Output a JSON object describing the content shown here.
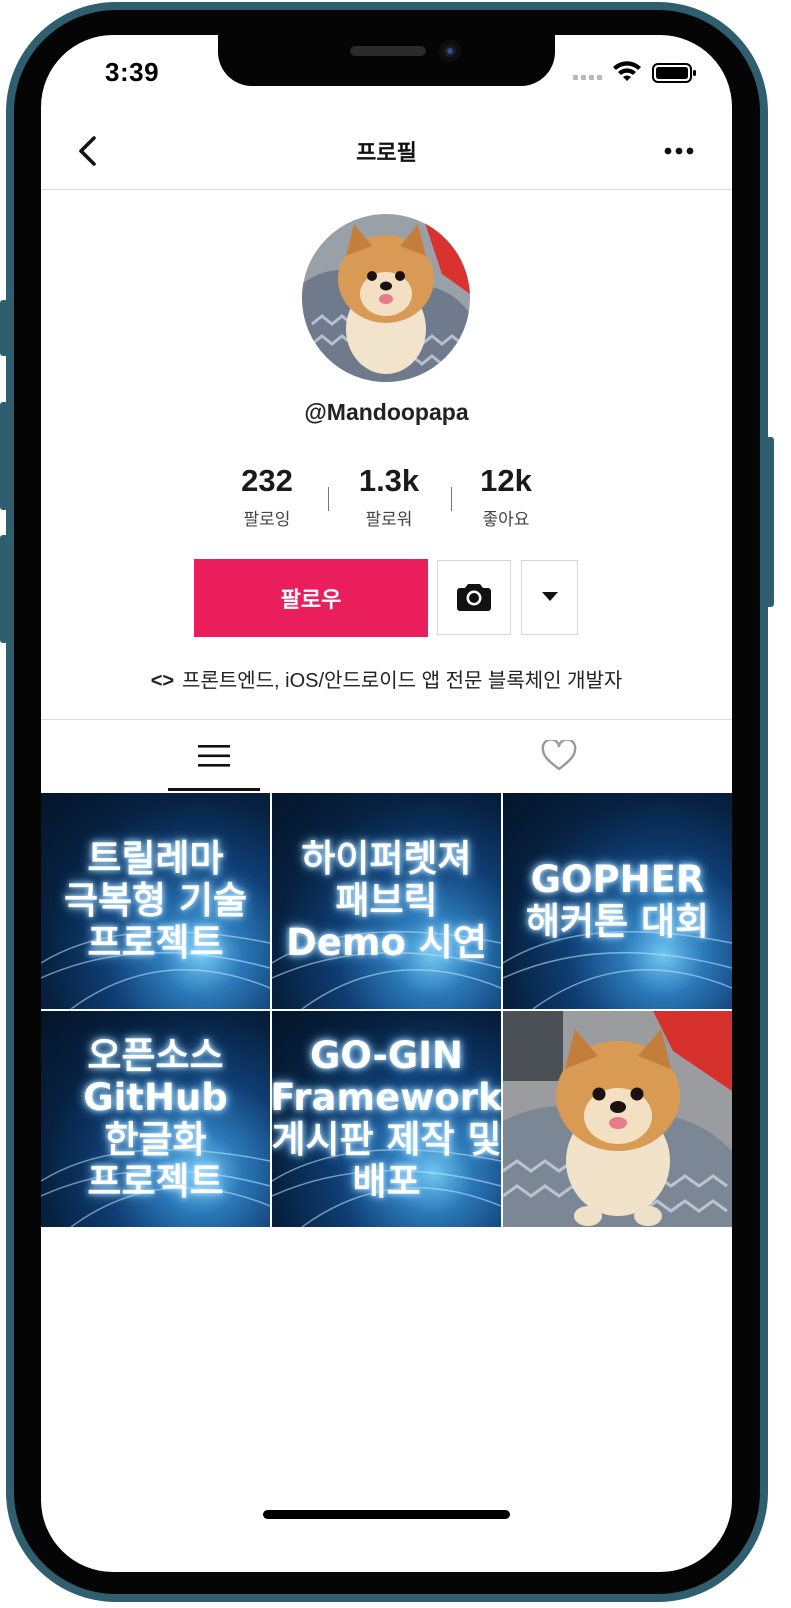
{
  "status_bar": {
    "time": "3:39"
  },
  "nav": {
    "title": "프로필"
  },
  "profile": {
    "username": "@Mandoopapa",
    "stats": [
      {
        "value": "232",
        "label": "팔로잉"
      },
      {
        "value": "1.3k",
        "label": "팔로워"
      },
      {
        "value": "12k",
        "label": "좋아요"
      }
    ],
    "follow_label": "팔로우",
    "bio_symbol": "<>",
    "bio": "프론트엔드, iOS/안드로이드 앱 전문 블록체인 개발자"
  },
  "tabs": [
    {
      "icon": "menu-icon",
      "active": true
    },
    {
      "icon": "heart-icon",
      "active": false
    }
  ],
  "posts": [
    {
      "caption": "트릴레마\n극복형 기술\n프로젝트"
    },
    {
      "caption": "하이퍼렛져\n패브릭\nDemo 시연"
    },
    {
      "caption": "GOPHER\n해커톤 대회"
    },
    {
      "caption": "오픈소스\nGitHub\n한글화\n프로젝트"
    },
    {
      "caption": "GO-GIN\nFramework\n게시판 제작 및\n배포"
    },
    {
      "caption": ""
    }
  ],
  "colors": {
    "accent": "#ea1d5d",
    "frame": "#2f5f6e"
  }
}
